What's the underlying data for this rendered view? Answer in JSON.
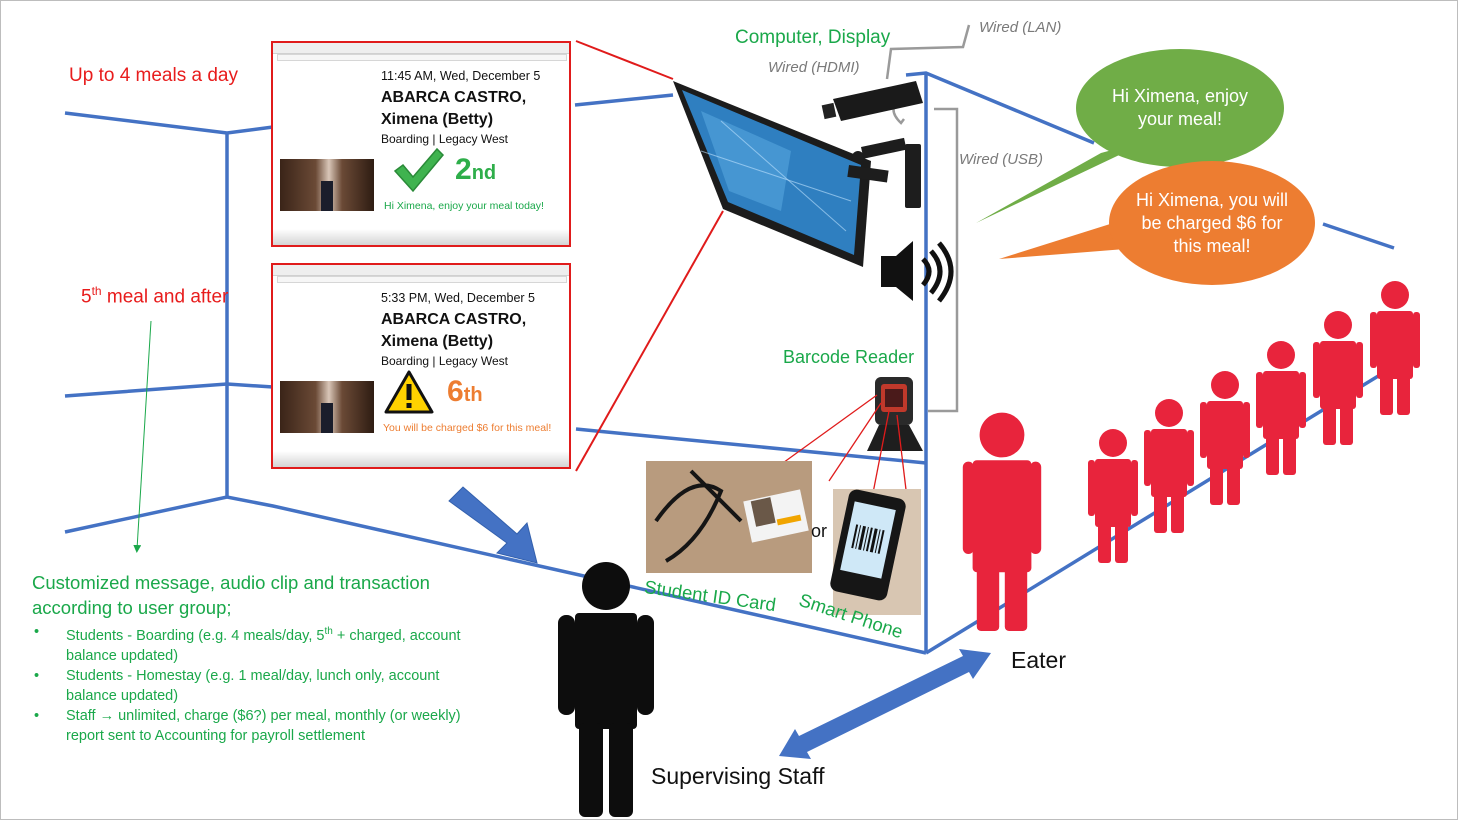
{
  "labels": {
    "computer_display": "Computer, Display",
    "wired_lan": "Wired (LAN)",
    "wired_hdmi": "Wired (HDMI)",
    "wired_usb": "Wired (USB)",
    "barcode_reader": "Barcode Reader",
    "student_id": "Student ID Card",
    "or": "or",
    "smart_phone": "Smart Phone",
    "eater": "Eater",
    "supervising_staff": "Supervising Staff"
  },
  "rules": {
    "up_to_four": "Up to 4 meals a day",
    "fifth_prefix": "5",
    "fifth_sup": "th",
    "fifth_rest": " meal and after"
  },
  "card1": {
    "time": "11:45 AM, Wed, December 5",
    "name_line1": "ABARCA CASTRO,",
    "name_line2": "Ximena (Betty)",
    "group": "Boarding | Legacy West",
    "ordinal_num": "2",
    "ordinal_sfx": "nd",
    "message": "Hi Ximena, enjoy your meal today!"
  },
  "card2": {
    "time": "5:33 PM, Wed, December 5",
    "name_line1": "ABARCA CASTRO,",
    "name_line2": "Ximena (Betty)",
    "group": "Boarding | Legacy West",
    "ordinal_num": "6",
    "ordinal_sfx": "th",
    "message": "You will be charged $6 for this meal!"
  },
  "bubbles": {
    "green": "Hi Ximena, enjoy your meal!",
    "orange": "Hi Ximena, you will be charged $6 for this meal!"
  },
  "description": {
    "heading": "Customized message, audio clip and transaction according to user group;",
    "item1_a": "Students - Boarding (e.g. 4 meals/day, 5",
    "item1_sup": "th",
    "item1_b": " + charged, account balance updated)",
    "item2": "Students - Homestay (e.g. 1 meal/day, lunch only, account balance updated)",
    "item3_a": "Staff ",
    "item3_arrow": "→",
    "item3_b": " unlimited, charge ($6?) per meal, monthly (or weekly) report sent to Accounting for payroll settlement"
  },
  "colors": {
    "red": "#e81c1c",
    "green": "#1aa84a",
    "blue": "#4472c4",
    "orange": "#ed7d31",
    "bubble_green": "#70ad47",
    "person_red": "#e8243c"
  },
  "icons": [
    "check-icon",
    "warning-icon",
    "speaker-icon",
    "barcode-scanner-icon",
    "monitor-icon",
    "person-icon",
    "double-arrow-icon"
  ]
}
